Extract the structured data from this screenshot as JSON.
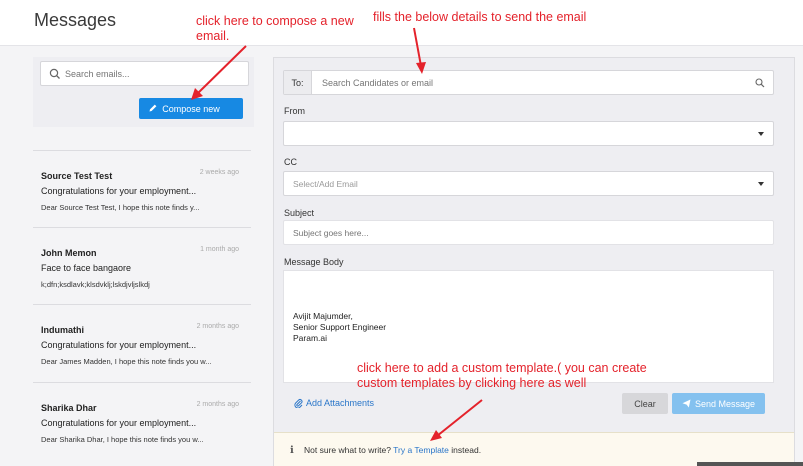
{
  "header": {
    "title": "Messages"
  },
  "left": {
    "search_placeholder": "Search emails...",
    "compose_label": "Compose new"
  },
  "mails": [
    {
      "sender": "Source Test Test",
      "time": "2 weeks ago",
      "subject": "Congratulations for your employment...",
      "snippet": "Dear Source Test Test, I hope this note finds y..."
    },
    {
      "sender": "John Memon",
      "time": "1 month ago",
      "subject": "Face to face bangaore",
      "snippet": "k;dfn;ksdlavk;klsdvklj;lskdjvljslkdj"
    },
    {
      "sender": "Indumathi",
      "time": "2 months ago",
      "subject": "Congratulations for your employment...",
      "snippet": "Dear James Madden, I hope this note finds you w..."
    },
    {
      "sender": "Sharika Dhar",
      "time": "2 months ago",
      "subject": "Congratulations for your employment...",
      "snippet": "Dear Sharika Dhar, I hope this note finds you w..."
    }
  ],
  "compose": {
    "to_label": "To:",
    "to_placeholder": "Search Candidates or email",
    "from_label": "From",
    "from_value": "",
    "cc_label": "CC",
    "cc_placeholder": "Select/Add Email",
    "subject_label": "Subject",
    "subject_placeholder": "Subject goes here...",
    "body_label": "Message Body",
    "signature": [
      "Avijit Majumder,",
      "Senior Support Engineer",
      "Param.ai"
    ],
    "attach_label": "Add Attachments",
    "clear_label": "Clear",
    "send_label": "Send Message"
  },
  "tip": {
    "prefix": "Not sure what to write?",
    "link": "Try a Template",
    "suffix": "instead."
  },
  "annotations": {
    "compose": "click here to compose a new email.",
    "details": "fills the below details to send the email",
    "template": "click here to add a custom template.( you can create custom templates by clicking here as well"
  },
  "colors": {
    "primary": "#1789e3",
    "send_disabled": "#84c1ef",
    "annotation": "#e4222b",
    "link": "#2a76c9"
  },
  "icons": {
    "search": "search-icon",
    "pencil": "pencil-icon",
    "attach": "paperclip-icon",
    "send": "paper-plane-icon",
    "info": "info-icon"
  }
}
